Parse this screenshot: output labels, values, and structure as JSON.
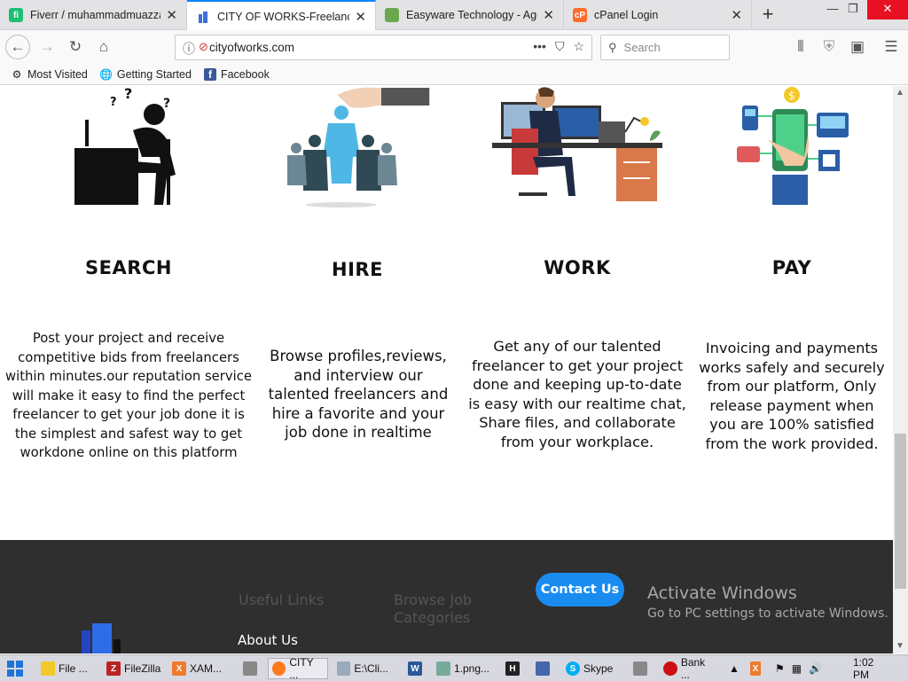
{
  "browser": {
    "tabs": [
      {
        "title": "Fiverr / muhammadmuazzam",
        "icon": "fiverr-icon",
        "color": "#1dbf73"
      },
      {
        "title": "CITY OF WORKS-Freelance m",
        "icon": "cityofworks-icon",
        "color": "#3a6fd8",
        "active": true
      },
      {
        "title": "Easyware Technology - Agen",
        "icon": "easyware-icon",
        "color": "#6aa84f"
      },
      {
        "title": "cPanel Login",
        "icon": "cpanel-icon",
        "color": "#ff6c2c"
      }
    ],
    "url": "cityofworks.com",
    "search_placeholder": "Search",
    "bookmarks": [
      "Most Visited",
      "Getting Started",
      "Facebook"
    ]
  },
  "steps": [
    {
      "title": "SEARCH",
      "text": "Post your project and receive competitive bids from freelancers within minutes.our reputation service will make it easy to find the perfect freelancer to get your job done it is the simplest and safest way to get workdone online on this platform"
    },
    {
      "title": "HIRE",
      "text": "Browse profiles,reviews, and interview our talented freelancers and hire a favorite  and your job done in realtime"
    },
    {
      "title": "WORK",
      "text": "Get any of our talented freelancer to get your project done and keeping up-to-date is easy with our realtime chat, Share files, and collaborate from your workplace."
    },
    {
      "title": "PAY",
      "text": "Invoicing and payments works safely and securely from our platform, Only release payment when you are 100%  satisfied from the work provided."
    }
  ],
  "footer": {
    "useful_links": "Useful Links",
    "browse_job": "Browse Job Categories",
    "about": "About Us",
    "contact": "Contact Us",
    "activate_title": "Activate Windows",
    "activate_sub": "Go to PC settings to activate Windows."
  },
  "taskbar": {
    "items": [
      "File ...",
      "FileZilla",
      "XAM...",
      "CITY ...",
      "E:\\Cli...",
      "1.png...",
      "Skype",
      "Bank ..."
    ],
    "time": "1:02 PM"
  },
  "colors": {
    "accent": "#1a8cf0",
    "footer_bg": "#2f2f2f"
  }
}
